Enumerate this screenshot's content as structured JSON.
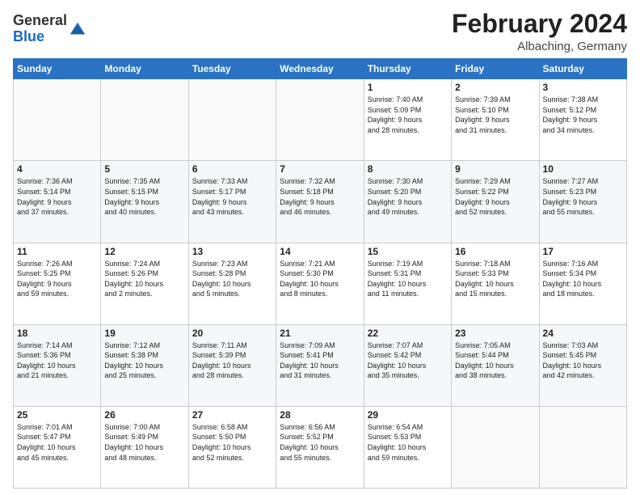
{
  "header": {
    "logo_general": "General",
    "logo_blue": "Blue",
    "month_title": "February 2024",
    "location": "Albaching, Germany"
  },
  "days_of_week": [
    "Sunday",
    "Monday",
    "Tuesday",
    "Wednesday",
    "Thursday",
    "Friday",
    "Saturday"
  ],
  "weeks": [
    [
      {
        "day": "",
        "info": ""
      },
      {
        "day": "",
        "info": ""
      },
      {
        "day": "",
        "info": ""
      },
      {
        "day": "",
        "info": ""
      },
      {
        "day": "1",
        "info": "Sunrise: 7:40 AM\nSunset: 5:09 PM\nDaylight: 9 hours\nand 28 minutes."
      },
      {
        "day": "2",
        "info": "Sunrise: 7:39 AM\nSunset: 5:10 PM\nDaylight: 9 hours\nand 31 minutes."
      },
      {
        "day": "3",
        "info": "Sunrise: 7:38 AM\nSunset: 5:12 PM\nDaylight: 9 hours\nand 34 minutes."
      }
    ],
    [
      {
        "day": "4",
        "info": "Sunrise: 7:36 AM\nSunset: 5:14 PM\nDaylight: 9 hours\nand 37 minutes."
      },
      {
        "day": "5",
        "info": "Sunrise: 7:35 AM\nSunset: 5:15 PM\nDaylight: 9 hours\nand 40 minutes."
      },
      {
        "day": "6",
        "info": "Sunrise: 7:33 AM\nSunset: 5:17 PM\nDaylight: 9 hours\nand 43 minutes."
      },
      {
        "day": "7",
        "info": "Sunrise: 7:32 AM\nSunset: 5:18 PM\nDaylight: 9 hours\nand 46 minutes."
      },
      {
        "day": "8",
        "info": "Sunrise: 7:30 AM\nSunset: 5:20 PM\nDaylight: 9 hours\nand 49 minutes."
      },
      {
        "day": "9",
        "info": "Sunrise: 7:29 AM\nSunset: 5:22 PM\nDaylight: 9 hours\nand 52 minutes."
      },
      {
        "day": "10",
        "info": "Sunrise: 7:27 AM\nSunset: 5:23 PM\nDaylight: 9 hours\nand 55 minutes."
      }
    ],
    [
      {
        "day": "11",
        "info": "Sunrise: 7:26 AM\nSunset: 5:25 PM\nDaylight: 9 hours\nand 59 minutes."
      },
      {
        "day": "12",
        "info": "Sunrise: 7:24 AM\nSunset: 5:26 PM\nDaylight: 10 hours\nand 2 minutes."
      },
      {
        "day": "13",
        "info": "Sunrise: 7:23 AM\nSunset: 5:28 PM\nDaylight: 10 hours\nand 5 minutes."
      },
      {
        "day": "14",
        "info": "Sunrise: 7:21 AM\nSunset: 5:30 PM\nDaylight: 10 hours\nand 8 minutes."
      },
      {
        "day": "15",
        "info": "Sunrise: 7:19 AM\nSunset: 5:31 PM\nDaylight: 10 hours\nand 11 minutes."
      },
      {
        "day": "16",
        "info": "Sunrise: 7:18 AM\nSunset: 5:33 PM\nDaylight: 10 hours\nand 15 minutes."
      },
      {
        "day": "17",
        "info": "Sunrise: 7:16 AM\nSunset: 5:34 PM\nDaylight: 10 hours\nand 18 minutes."
      }
    ],
    [
      {
        "day": "18",
        "info": "Sunrise: 7:14 AM\nSunset: 5:36 PM\nDaylight: 10 hours\nand 21 minutes."
      },
      {
        "day": "19",
        "info": "Sunrise: 7:12 AM\nSunset: 5:38 PM\nDaylight: 10 hours\nand 25 minutes."
      },
      {
        "day": "20",
        "info": "Sunrise: 7:11 AM\nSunset: 5:39 PM\nDaylight: 10 hours\nand 28 minutes."
      },
      {
        "day": "21",
        "info": "Sunrise: 7:09 AM\nSunset: 5:41 PM\nDaylight: 10 hours\nand 31 minutes."
      },
      {
        "day": "22",
        "info": "Sunrise: 7:07 AM\nSunset: 5:42 PM\nDaylight: 10 hours\nand 35 minutes."
      },
      {
        "day": "23",
        "info": "Sunrise: 7:05 AM\nSunset: 5:44 PM\nDaylight: 10 hours\nand 38 minutes."
      },
      {
        "day": "24",
        "info": "Sunrise: 7:03 AM\nSunset: 5:45 PM\nDaylight: 10 hours\nand 42 minutes."
      }
    ],
    [
      {
        "day": "25",
        "info": "Sunrise: 7:01 AM\nSunset: 5:47 PM\nDaylight: 10 hours\nand 45 minutes."
      },
      {
        "day": "26",
        "info": "Sunrise: 7:00 AM\nSunset: 5:49 PM\nDaylight: 10 hours\nand 48 minutes."
      },
      {
        "day": "27",
        "info": "Sunrise: 6:58 AM\nSunset: 5:50 PM\nDaylight: 10 hours\nand 52 minutes."
      },
      {
        "day": "28",
        "info": "Sunrise: 6:56 AM\nSunset: 5:52 PM\nDaylight: 10 hours\nand 55 minutes."
      },
      {
        "day": "29",
        "info": "Sunrise: 6:54 AM\nSunset: 5:53 PM\nDaylight: 10 hours\nand 59 minutes."
      },
      {
        "day": "",
        "info": ""
      },
      {
        "day": "",
        "info": ""
      }
    ]
  ]
}
